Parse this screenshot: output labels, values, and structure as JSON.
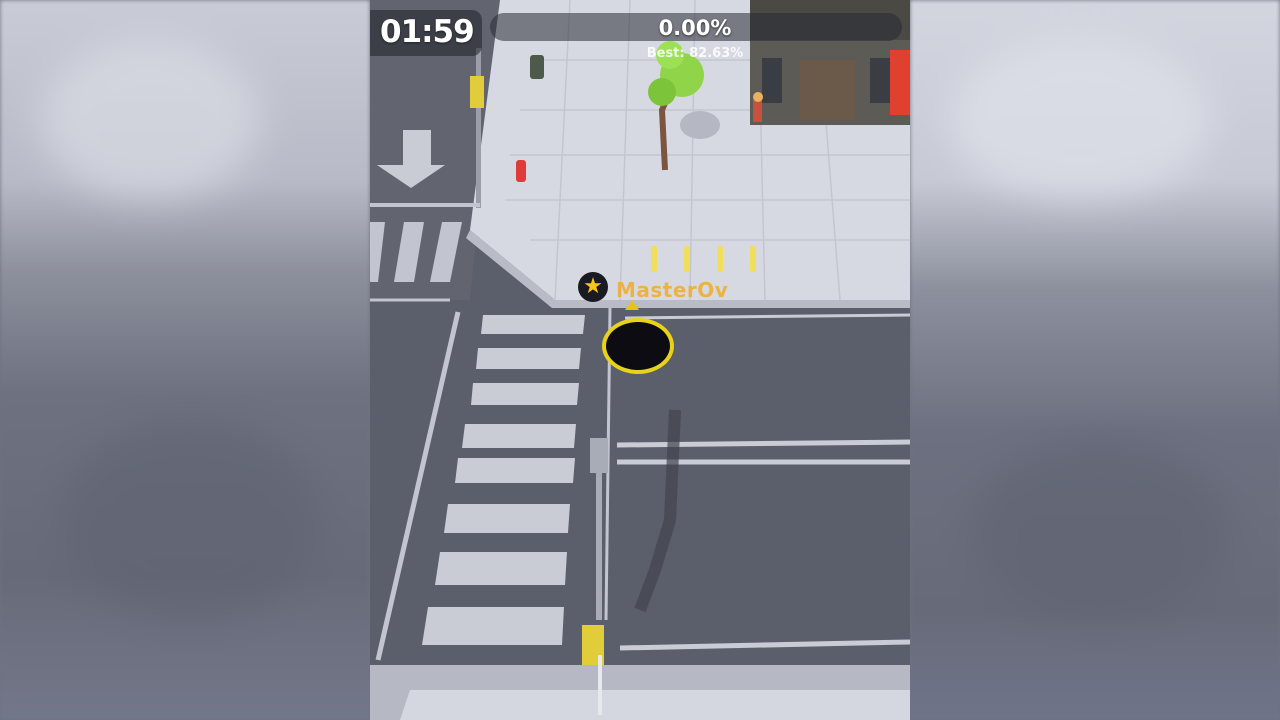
{
  "hud": {
    "timer": "01:59",
    "progress_percent_text": "0.00%",
    "progress_value": 0.0,
    "best_text": "Best: 82.63%"
  },
  "player": {
    "name": "MasterOv",
    "badge_icon": "star-icon"
  },
  "colors": {
    "accent": "#e8c21a",
    "road": "#5b5e6b",
    "sidewalk": "#d8dae3",
    "hole_rim": "#e8d21a"
  }
}
